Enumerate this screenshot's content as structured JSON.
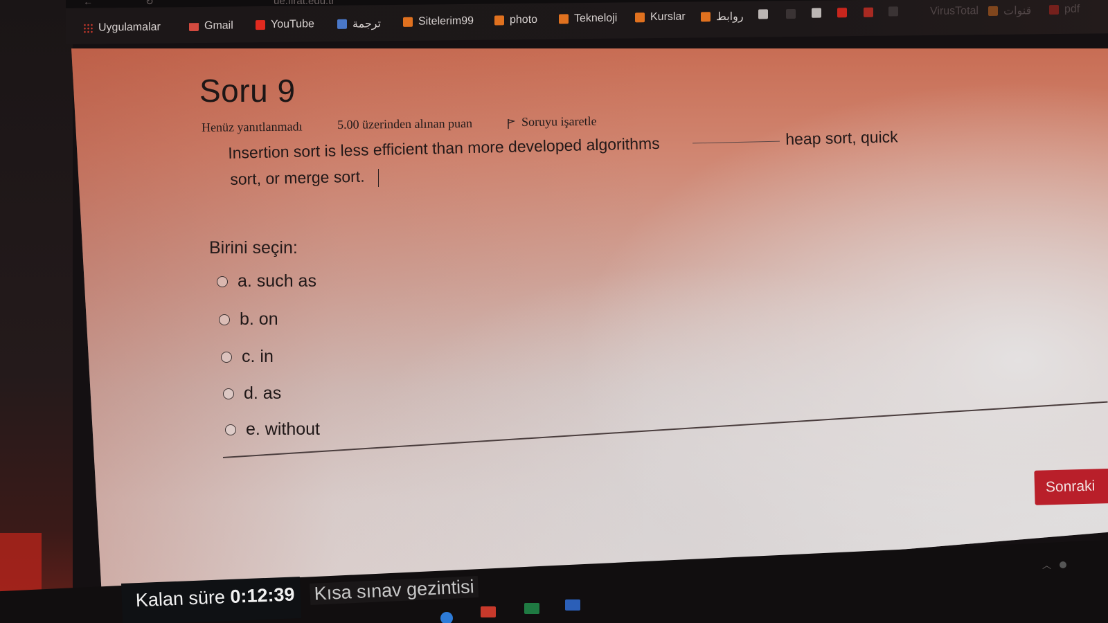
{
  "browser": {
    "url": "ue.firat.edu.tr",
    "bookmarks": [
      {
        "label": "Uygulamalar",
        "icon": "apps-grid-icon"
      },
      {
        "label": "Gmail",
        "icon": "gmail-icon"
      },
      {
        "label": "YouTube",
        "icon": "youtube-icon"
      },
      {
        "label": "ترجمة",
        "icon": "translate-icon"
      },
      {
        "label": "Sitelerim99",
        "icon": "folder-icon"
      },
      {
        "label": "photo",
        "icon": "folder-icon"
      },
      {
        "label": "Tekneloji",
        "icon": "folder-icon"
      },
      {
        "label": "Kurslar",
        "icon": "folder-icon"
      },
      {
        "label": "روابط",
        "icon": "folder-icon"
      },
      {
        "label": "VirusTotal",
        "icon": "virustotal-icon"
      },
      {
        "label": "قنوات",
        "icon": "folder-icon"
      },
      {
        "label": "pdf",
        "icon": "pdf-icon"
      }
    ]
  },
  "question": {
    "title": "Soru 9",
    "status": "Henüz yanıtlanmadı",
    "points": "5.00 üzerinden alınan puan",
    "flag_label": "Soruyu işaretle",
    "text_part1": "Insertion sort is less efficient than more developed algorithms",
    "text_part2": "heap sort, quick",
    "text_part3": "sort, or merge sort.",
    "choose_label": "Birini seçin:",
    "options": [
      {
        "label": "a. such as"
      },
      {
        "label": "b. on"
      },
      {
        "label": "c. in"
      },
      {
        "label": "d. as"
      },
      {
        "label": "e. without"
      }
    ]
  },
  "navigation": {
    "next_label": "Sonraki"
  },
  "footer": {
    "timer_label": "Kalan süre",
    "timer_value": "0:12:39",
    "quiz_nav_label": "Kısa sınav gezintisi"
  },
  "colors": {
    "next_button": "#b91f2a",
    "page_top_tint": "#c86d54",
    "page_background": "#e1dfdf"
  }
}
